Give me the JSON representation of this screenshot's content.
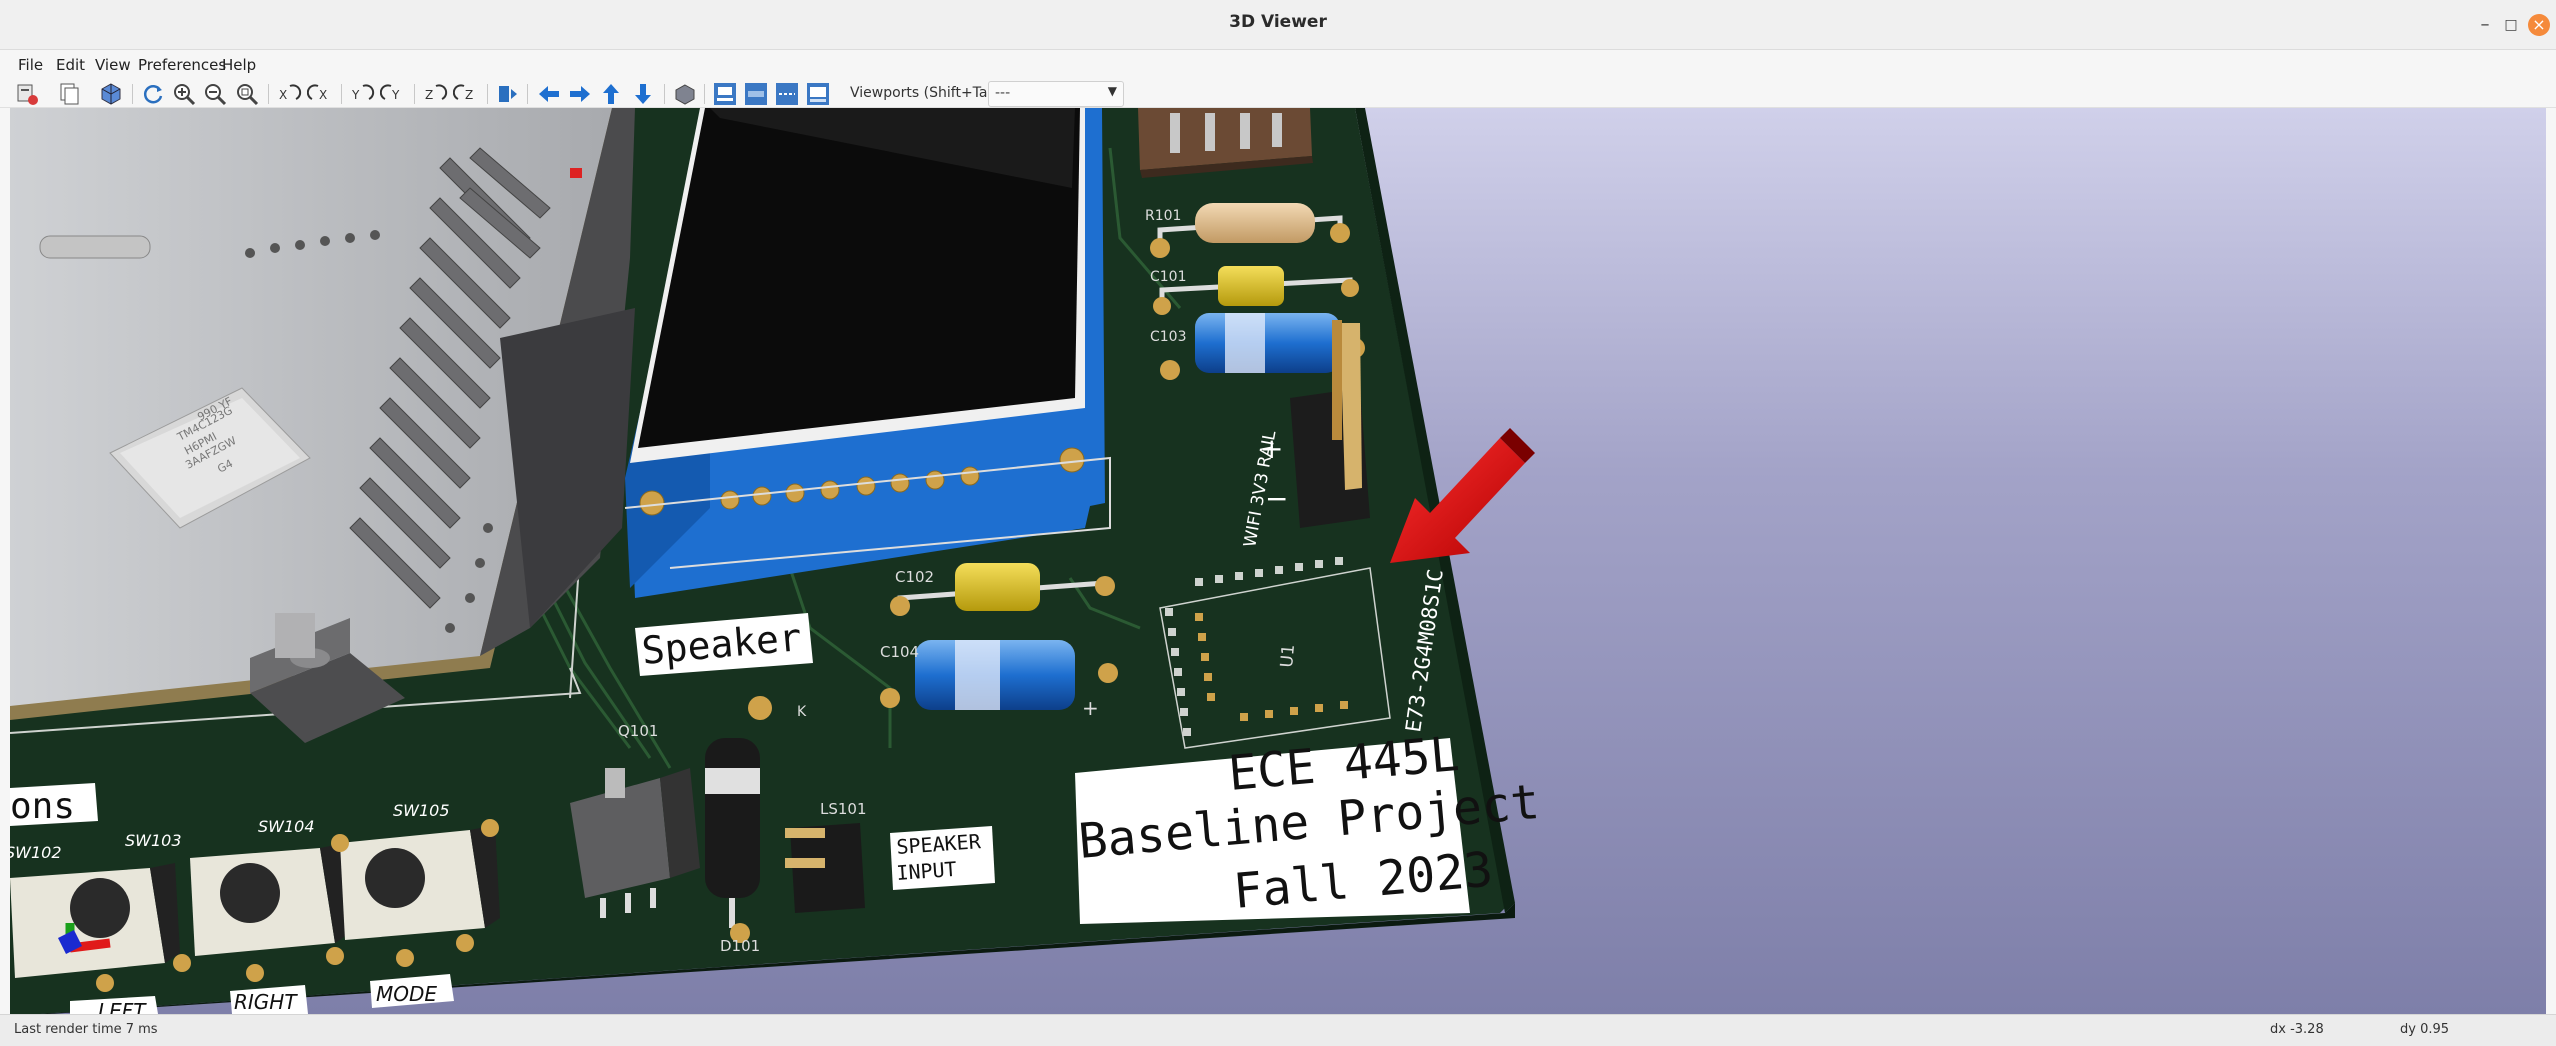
{
  "window": {
    "title": "3D Viewer"
  },
  "menu": [
    "File",
    "Edit",
    "View",
    "Preferences",
    "Help"
  ],
  "toolbar": {
    "viewports_label": "Viewports (Shift+Tab):",
    "viewports_value": "---"
  },
  "board": {
    "title_lines": [
      "ECE 445L",
      "Baseline Project",
      "Fall 2023"
    ],
    "speaker_label": "Speaker",
    "speaker_input": [
      "SPEAKER",
      "INPUT"
    ],
    "wifi_label": "WIFI 3V3 RAIL",
    "module_label": "E73-2G4M08S1C",
    "module_ref": "U1",
    "buttons_fragment": "ons",
    "button_captions": [
      "LEFT",
      "RIGHT",
      "MODE"
    ],
    "refdes": [
      "R101",
      "C101",
      "C103",
      "C102",
      "C104",
      "Q101",
      "D101",
      "LS101",
      "SW102",
      "SW103",
      "SW104",
      "SW105",
      "K"
    ],
    "chip_text": [
      "990  YF",
      "TM4C123G",
      "H6PMI",
      "3AAFZGW",
      "G4"
    ],
    "plus_sign": "+",
    "minus_sign": "−"
  },
  "status": {
    "render_time": "Last render time 7 ms",
    "dx": "dx -3.28",
    "dy": "dy 0.95"
  }
}
